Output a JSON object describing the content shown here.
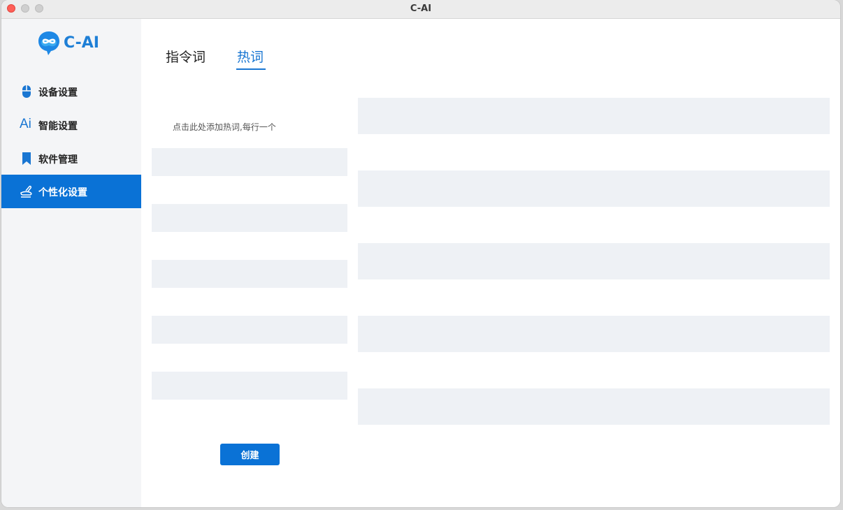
{
  "window": {
    "title": "C-AI"
  },
  "logo": {
    "text": "C-AI",
    "icon": "infinity-chat-bubble-icon"
  },
  "sidebar": {
    "items": [
      {
        "label": "设备设置",
        "icon": "mouse-icon",
        "active": false
      },
      {
        "label": "智能设置",
        "icon": "ai-text-icon",
        "icon_text": "Ai",
        "active": false
      },
      {
        "label": "软件管理",
        "icon": "bookmark-icon",
        "active": false
      },
      {
        "label": "个性化设置",
        "icon": "hand-wave-icon",
        "active": true
      }
    ]
  },
  "tabs": [
    {
      "label": "指令词",
      "active": false
    },
    {
      "label": "热词",
      "active": true
    }
  ],
  "hotwords": {
    "placeholder": "点击此处添加热词,每行一个",
    "create_label": "创建"
  },
  "colors": {
    "accent": "#0a72d6",
    "sidebar_bg": "#f4f5f7",
    "stripe": "#eef1f5",
    "close": "#fe5f57"
  }
}
